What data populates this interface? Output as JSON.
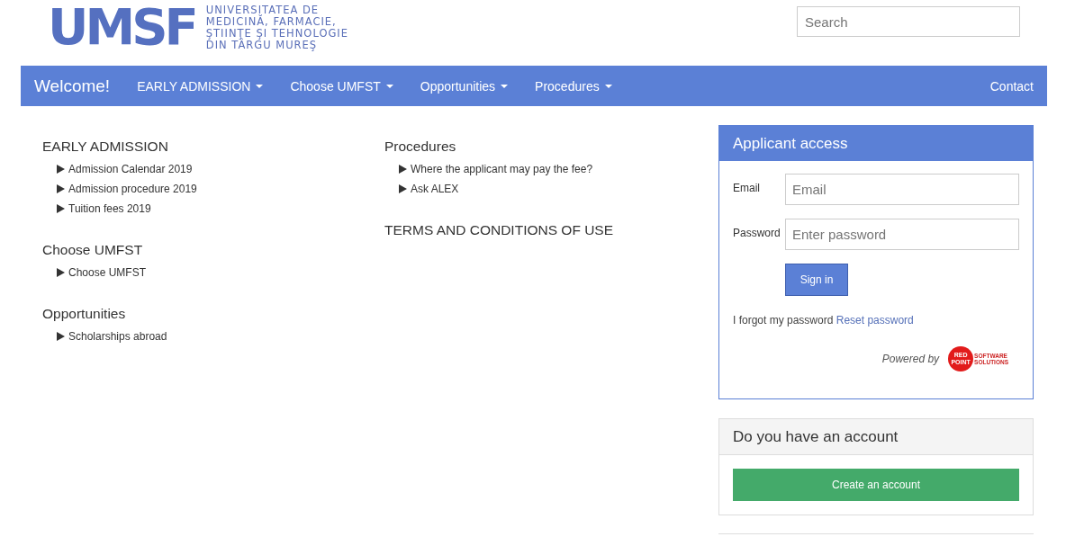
{
  "logo": {
    "mark": "UMSF",
    "lines": [
      "UNIVERSITATEA DE",
      "MEDICINĂ, FARMACIE,",
      "ŞTIINŢE ŞI TEHNOLOGIE",
      "DIN TÂRGU MUREŞ"
    ]
  },
  "search": {
    "placeholder": "Search"
  },
  "nav": {
    "brand": "Welcome!",
    "items": [
      {
        "label": "EARLY ADMISSION",
        "dropdown": true
      },
      {
        "label": "Choose UMFST",
        "dropdown": true
      },
      {
        "label": "Opportunities",
        "dropdown": true
      },
      {
        "label": "Procedures",
        "dropdown": true
      }
    ],
    "right": "Contact"
  },
  "columns": [
    [
      {
        "title": "EARLY ADMISSION",
        "links": [
          "Admission Calendar 2019",
          "Admission procedure 2019",
          "Tuition fees 2019"
        ]
      },
      {
        "title": "Choose UMFST",
        "links": [
          "Choose UMFST"
        ]
      },
      {
        "title": "Opportunities",
        "links": [
          "Scholarships abroad"
        ]
      }
    ],
    [
      {
        "title": "Procedures",
        "links": [
          "Where the applicant may pay the fee?",
          "Ask ALEX"
        ]
      },
      {
        "title": "TERMS AND CONDITIONS OF USE"
      }
    ]
  ],
  "login": {
    "title": "Applicant access",
    "fields": [
      {
        "label": "Email",
        "placeholder": "Email"
      },
      {
        "label": "Password",
        "placeholder": "Enter password"
      }
    ],
    "button": "Sign in",
    "forgot": "I forgot my password",
    "reset": "Reset password",
    "powered": "Powered by",
    "vendor_top": "RED",
    "vendor_bottom": "POINT",
    "vendor_right_top": "SOFTWARE",
    "vendor_right_bottom": "SOLUTIONS"
  },
  "account": {
    "title": "Do you have an account",
    "button": "Create an account"
  }
}
